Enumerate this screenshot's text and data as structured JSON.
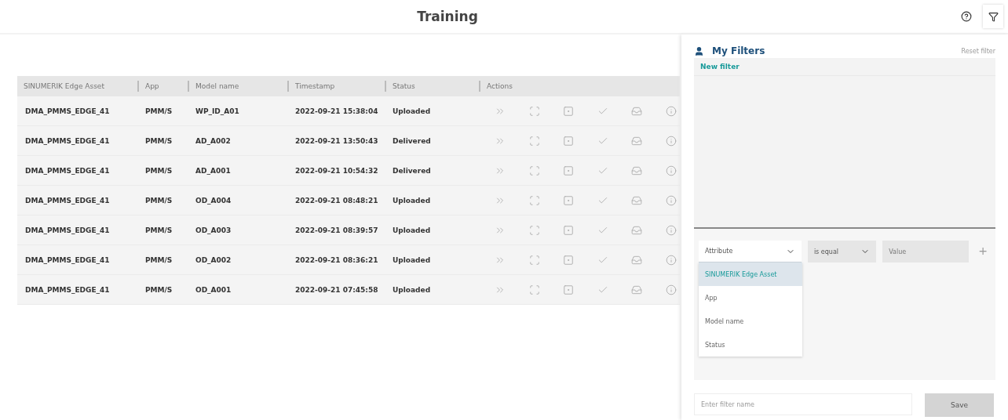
{
  "header": {
    "title": "Training"
  },
  "table": {
    "columns": [
      "SINUMERIK Edge Asset",
      "App",
      "Model name",
      "Timestamp",
      "Status",
      "Actions"
    ],
    "rows": [
      {
        "asset": "DMA_PMMS_EDGE_41",
        "app": "PMM/S",
        "model": "WP_ID_A01",
        "timestamp": "2022-09-21 15:38:04",
        "status": "Uploaded"
      },
      {
        "asset": "DMA_PMMS_EDGE_41",
        "app": "PMM/S",
        "model": "AD_A002",
        "timestamp": "2022-09-21 13:50:43",
        "status": "Delivered"
      },
      {
        "asset": "DMA_PMMS_EDGE_41",
        "app": "PMM/S",
        "model": "AD_A001",
        "timestamp": "2022-09-21 10:54:32",
        "status": "Delivered"
      },
      {
        "asset": "DMA_PMMS_EDGE_41",
        "app": "PMM/S",
        "model": "OD_A004",
        "timestamp": "2022-09-21 08:48:21",
        "status": "Uploaded"
      },
      {
        "asset": "DMA_PMMS_EDGE_41",
        "app": "PMM/S",
        "model": "OD_A003",
        "timestamp": "2022-09-21 08:39:57",
        "status": "Uploaded"
      },
      {
        "asset": "DMA_PMMS_EDGE_41",
        "app": "PMM/S",
        "model": "OD_A002",
        "timestamp": "2022-09-21 08:36:21",
        "status": "Uploaded"
      },
      {
        "asset": "DMA_PMMS_EDGE_41",
        "app": "PMM/S",
        "model": "OD_A001",
        "timestamp": "2022-09-21 07:45:58",
        "status": "Uploaded"
      }
    ]
  },
  "filters": {
    "title": "My Filters",
    "reset": "Reset filter",
    "new_filter": "New filter",
    "attribute": {
      "placeholder": "Attribute",
      "expanded": true,
      "options": [
        {
          "label": "SINUMERIK Edge Asset",
          "selected": true
        },
        {
          "label": "App",
          "selected": false
        },
        {
          "label": "Model name",
          "selected": false
        },
        {
          "label": "Status",
          "selected": false
        }
      ]
    },
    "operator": {
      "value": "is equal"
    },
    "value": {
      "placeholder": "Value"
    },
    "add": "+",
    "name": {
      "placeholder": "Enter filter name"
    },
    "save": "Save"
  }
}
